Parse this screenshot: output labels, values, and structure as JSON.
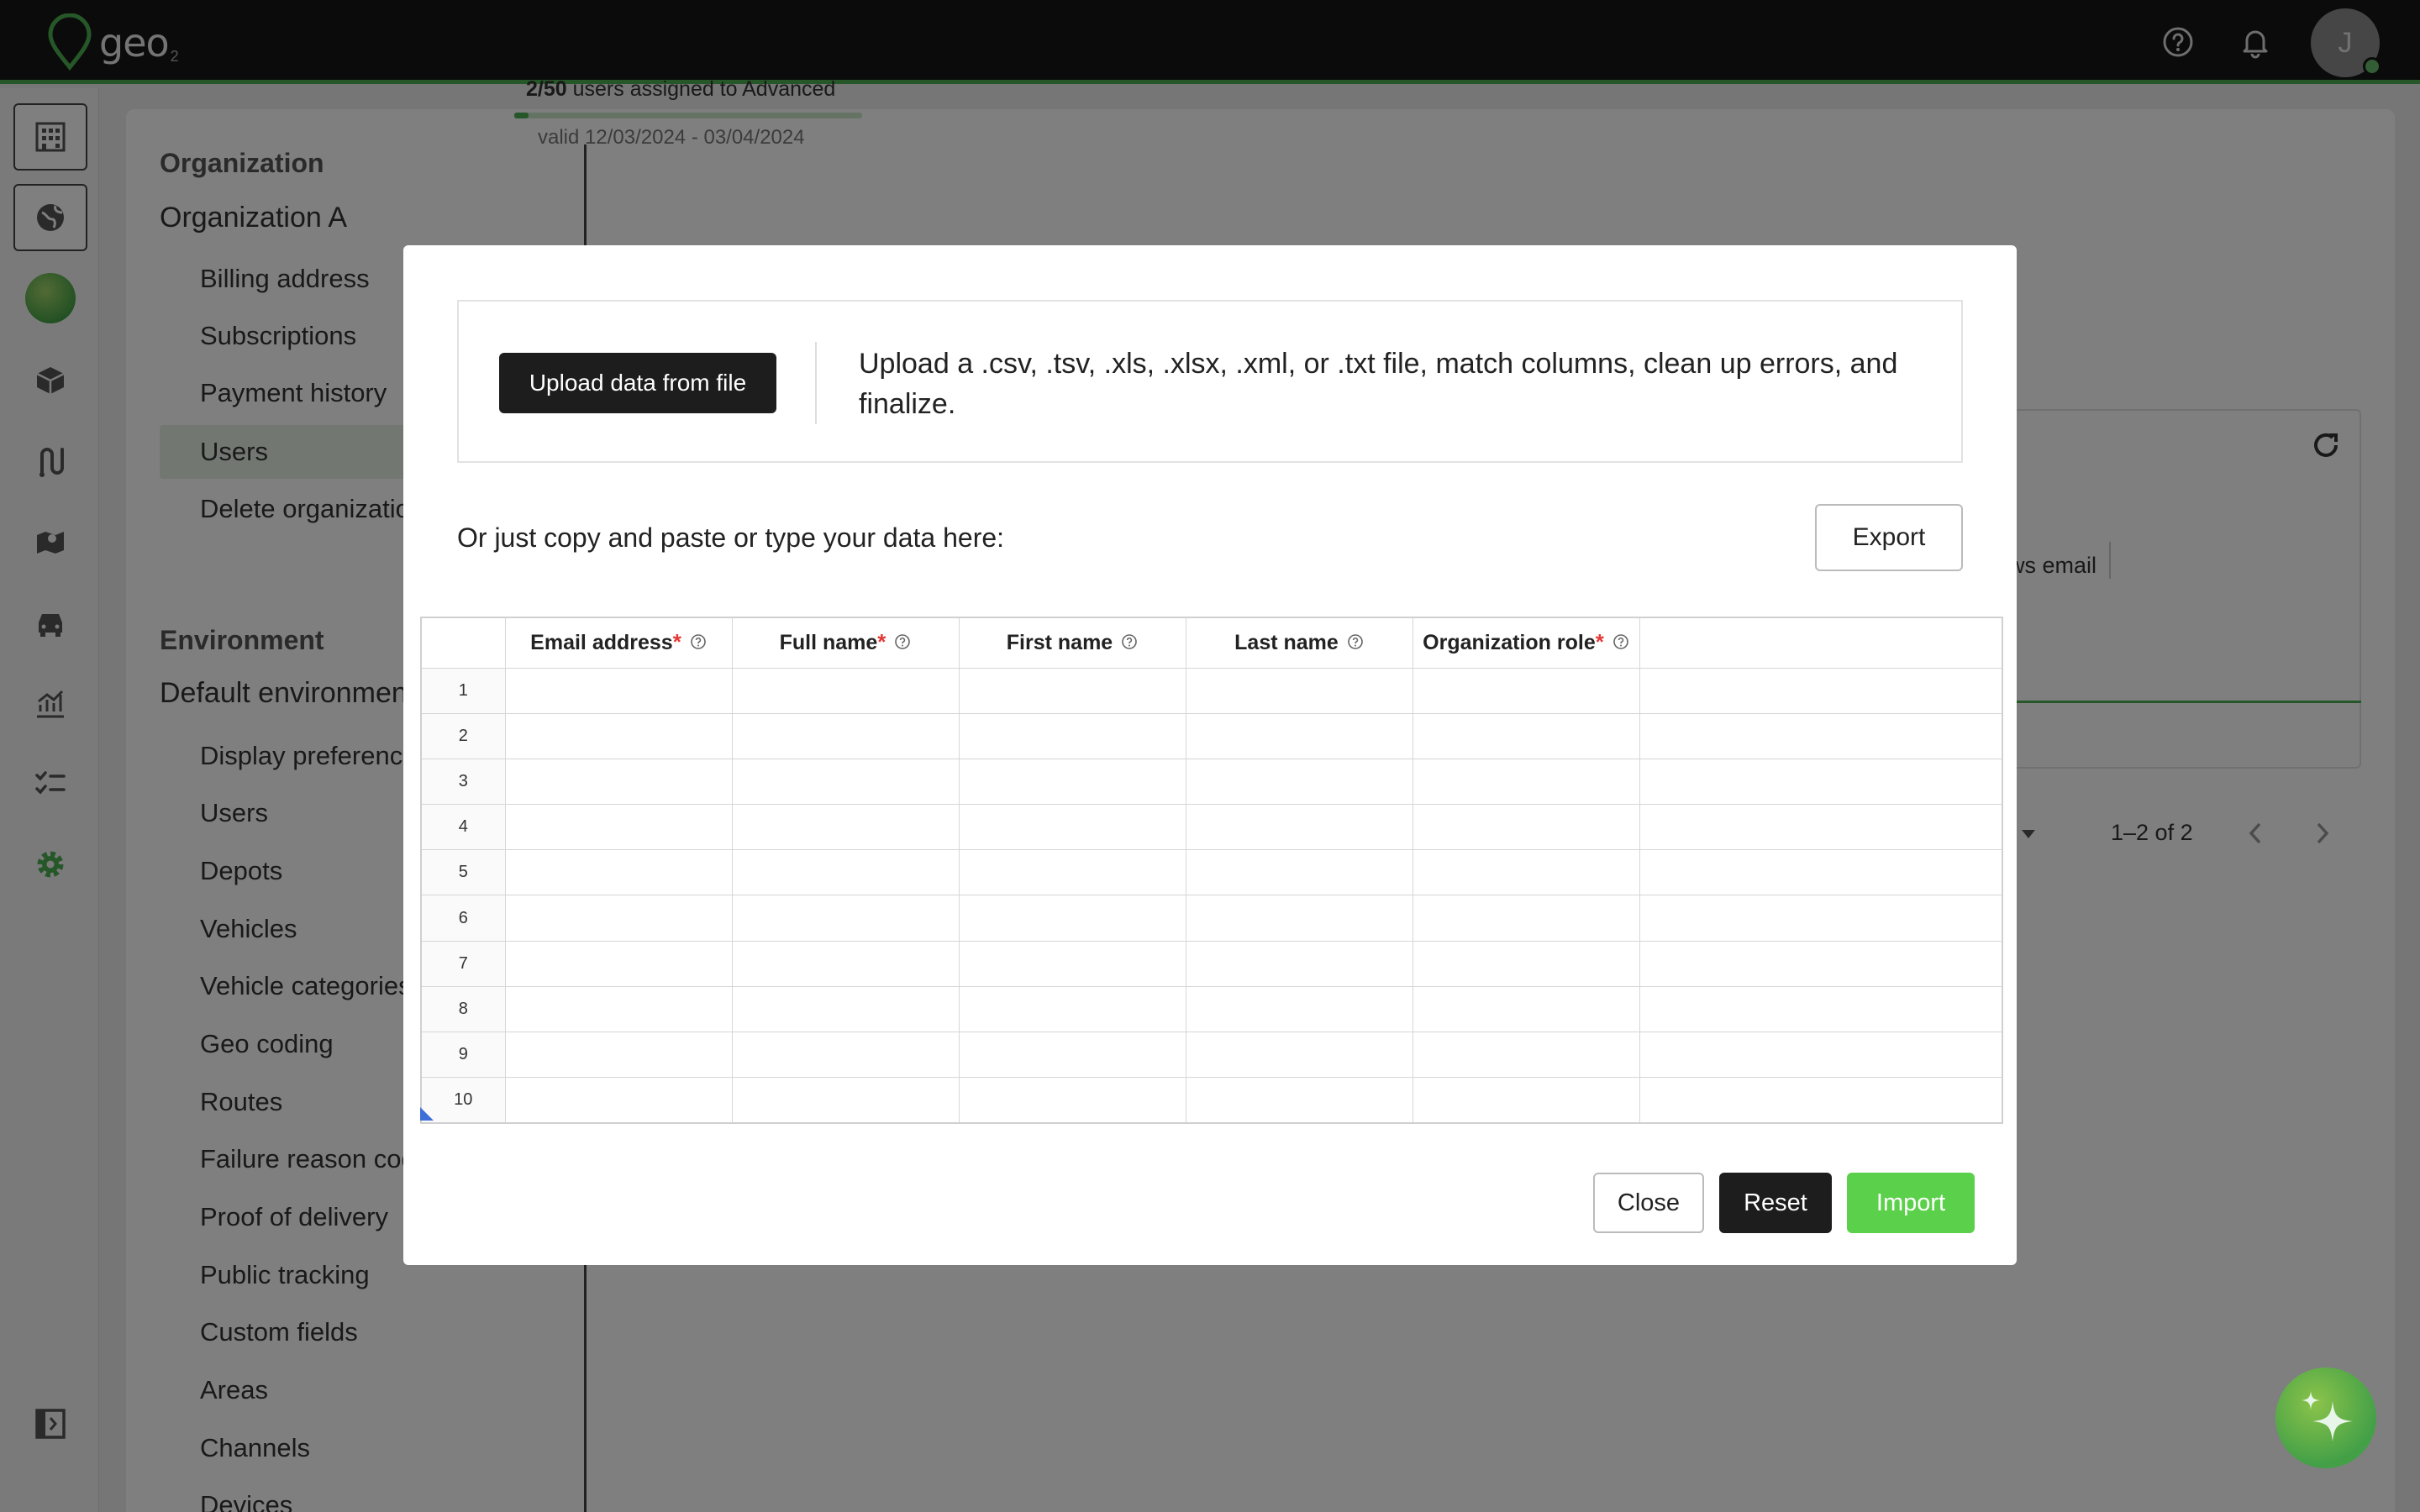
{
  "app": {
    "logo_text": "geo",
    "logo_sub": "2",
    "avatar_initial": "J"
  },
  "sidebar": {
    "section_org": "Organization",
    "org_name": "Organization A",
    "org_items": [
      "Billing address",
      "Subscriptions",
      "Payment history",
      "Users",
      "Delete organization"
    ],
    "section_env": "Environment",
    "env_name": "Default environment",
    "env_items": [
      "Display preferences",
      "Users",
      "Depots",
      "Vehicles",
      "Vehicle categories",
      "Geo coding",
      "Routes",
      "Failure reason codes",
      "Proof of delivery",
      "Public tracking",
      "Custom fields",
      "Areas",
      "Channels",
      "Devices"
    ]
  },
  "background": {
    "usage_count": "2/50",
    "usage_text": " users assigned to Advanced",
    "usage_fraction": 0.04,
    "validity": "valid 12/03/2024 - 03/04/2024",
    "table_col_email": "ws email",
    "pager": "1–2 of 2"
  },
  "modal": {
    "upload_button": "Upload data from file",
    "upload_description": "Upload a .csv, .tsv, .xls, .xlsx, .xml, or .txt file, match columns, clean up errors, and finalize.",
    "paste_prompt": "Or just copy and paste or type your data here:",
    "export_button": "Export",
    "columns": [
      {
        "label": "Email address",
        "required": "*"
      },
      {
        "label": "Full name",
        "required": "*"
      },
      {
        "label": "First name",
        "required": ""
      },
      {
        "label": "Last name",
        "required": ""
      },
      {
        "label": "Organization role",
        "required": "*"
      }
    ],
    "rows": [
      "1",
      "2",
      "3",
      "4",
      "5",
      "6",
      "7",
      "8",
      "9",
      "10"
    ],
    "close_button": "Close",
    "reset_button": "Reset",
    "import_button": "Import"
  },
  "colors": {
    "accent": "#4caf50",
    "import": "#5bd04a",
    "required": "#e53935"
  }
}
